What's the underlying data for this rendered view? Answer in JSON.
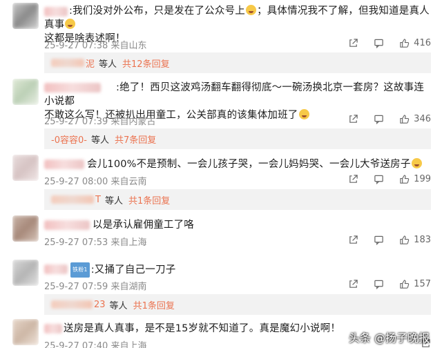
{
  "comments": [
    {
      "text_a": ":我们没对外公布，只是发在了公众号上",
      "text_b": "；具体情况我不了解，但我知道是真人真事",
      "text_c": "这都是啥表述啊！",
      "time": "25-9-27 07:38",
      "location": "来自山东",
      "likes": "416",
      "reply": {
        "name": "泥",
        "deng": "等人",
        "link": "共12条回复"
      }
    },
    {
      "text_a": ":绝了！西贝这波鸡汤翻车翻得彻底～一碗汤换北京一套房？这故事连小说都",
      "text_b": "不敢这么写！还被扒出用童工，公关部真的该集体加班了",
      "time": "25-9-27 07:39",
      "location": "来自内蒙古",
      "likes": "346",
      "reply": {
        "name": "-0容容0-",
        "deng": "等人",
        "link": "共7条回复"
      }
    },
    {
      "text_a": "会儿100%不是预制、一会儿孩子哭，一会儿妈妈哭、一会儿大爷送房子",
      "time": "25-9-27 08:00",
      "location": "来自云南",
      "likes": "199",
      "reply": {
        "name": "T",
        "deng": "等人",
        "link": "共1条回复"
      }
    },
    {
      "text_a": "以是承认雇佣童工了咯",
      "time": "25-9-27 07:53",
      "location": "来自上海",
      "likes": "183"
    },
    {
      "badge": "铁粉1",
      "text_a": ":又捅了自己一刀子",
      "time": "25-9-27 07:59",
      "location": "来自湖南",
      "likes": "157",
      "reply": {
        "name": "23",
        "deng": "等人",
        "link": "共1条回复"
      }
    },
    {
      "text_a": "送房是真人真事，是不是15岁就不知道了。真是魔幻小说啊！",
      "time": "25-9-27 07:40",
      "location": "来自上海"
    }
  ],
  "watermark": "头条 @扬子晚报",
  "colors": {
    "accent": "#eb7350",
    "meta": "#8a8a8a"
  },
  "icons": [
    "share-icon",
    "comment-icon",
    "like-icon"
  ]
}
